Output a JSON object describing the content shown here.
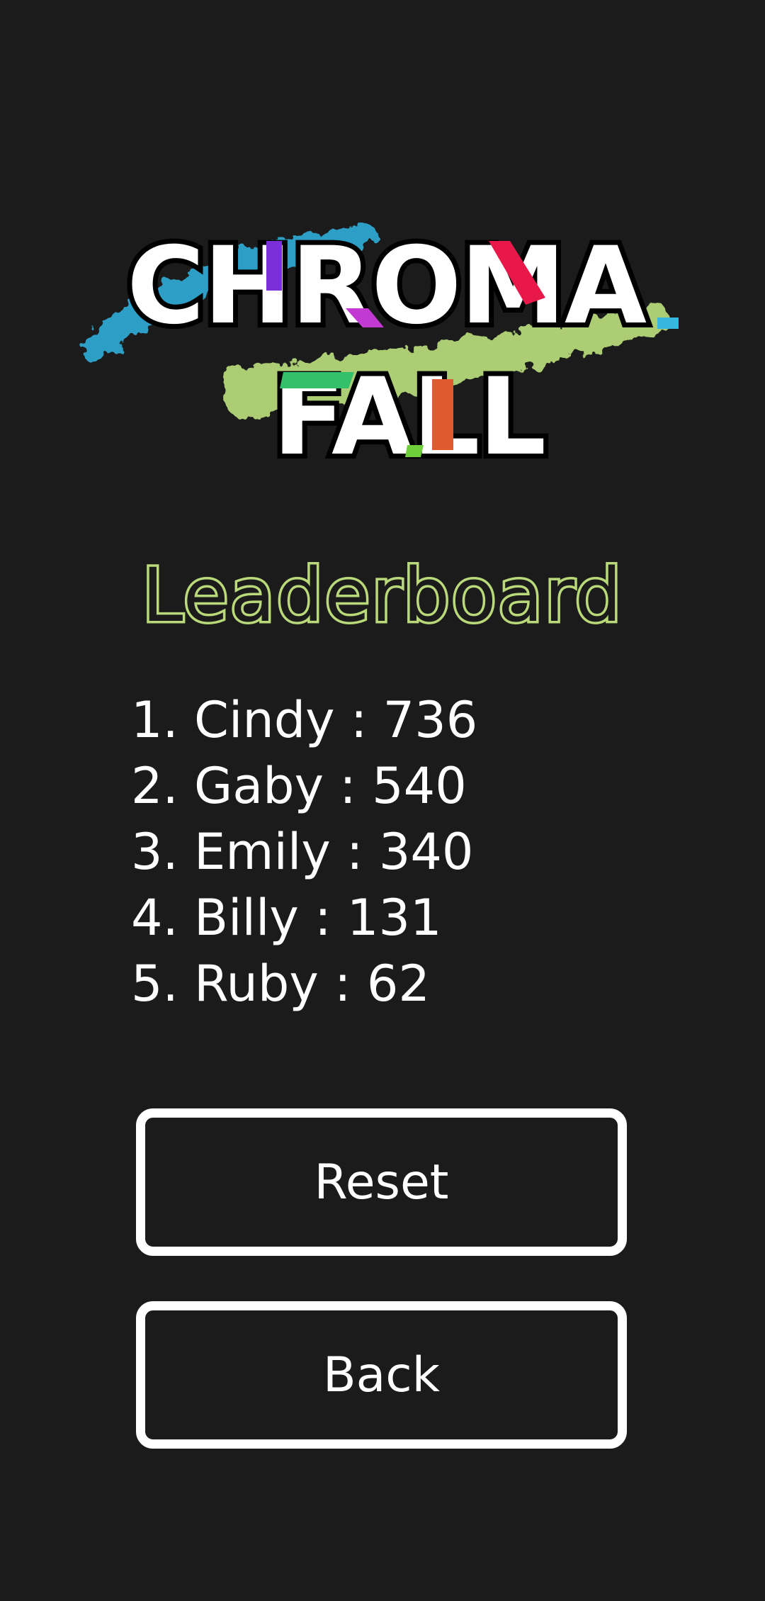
{
  "logo": {
    "line1": "CHROMA",
    "line2": "FALL",
    "colors": {
      "blue": "#2fa6cf",
      "green": "#b5d77a",
      "purple": "#7a2fd9",
      "magenta": "#c23ad2",
      "red": "#e8184a",
      "cyan": "#37b6e0",
      "emerald": "#34c06a",
      "orange": "#e05a30",
      "lime": "#6ecf3a"
    }
  },
  "leaderboard": {
    "title": "Leaderboard",
    "entries": [
      "1. Cindy : 736",
      "2. Gaby : 540",
      "3. Emily : 340",
      "4. Billy : 131",
      "5. Ruby : 62"
    ]
  },
  "buttons": {
    "reset": "Reset",
    "back": "Back"
  },
  "colors": {
    "background": "#1b1b1b",
    "title_outline": "#b9d97a",
    "text": "#ffffff"
  }
}
